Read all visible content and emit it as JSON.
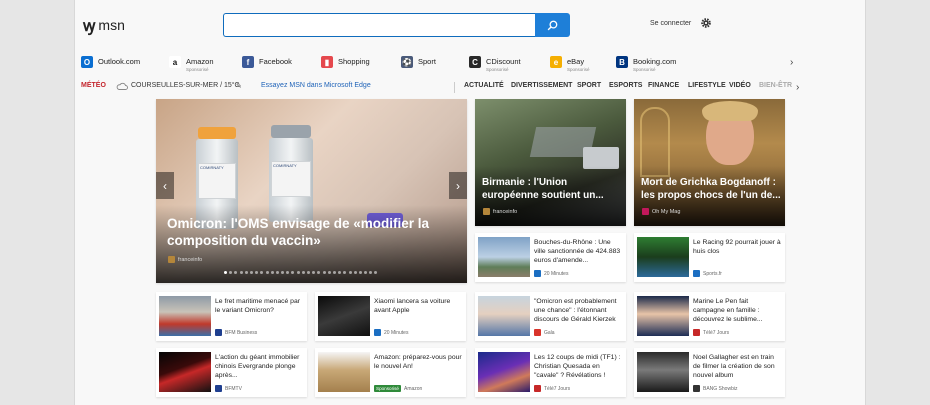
{
  "header": {
    "logo": "msn",
    "search_value": "",
    "signin": "Se connecter",
    "settings_icon": "gear-icon"
  },
  "quicklinks": [
    {
      "label": "Outlook.com",
      "sponsored": "",
      "color": "#0a6ed1",
      "glyph": "O",
      "icon": "outlook-icon"
    },
    {
      "label": "Amazon",
      "sponsored": "Sponsorisé",
      "color": "#ffffff",
      "glyph": "a",
      "icon": "amazon-icon"
    },
    {
      "label": "Facebook",
      "sponsored": "",
      "color": "#3b5998",
      "glyph": "f",
      "icon": "facebook-icon"
    },
    {
      "label": "Shopping",
      "sponsored": "",
      "color": "#e5484d",
      "glyph": "▮",
      "icon": "shopping-bag-icon"
    },
    {
      "label": "Sport",
      "sponsored": "",
      "color": "#4a5a7a",
      "glyph": "⚽",
      "icon": "sport-icon"
    },
    {
      "label": "CDiscount",
      "sponsored": "Sponsorisé",
      "color": "#2a2a2a",
      "glyph": "C",
      "icon": "cdiscount-icon"
    },
    {
      "label": "eBay",
      "sponsored": "Sponsorisé",
      "color": "#f5af02",
      "glyph": "e",
      "icon": "ebay-icon"
    },
    {
      "label": "Booking.com",
      "sponsored": "Sponsorisé",
      "color": "#003580",
      "glyph": "B",
      "icon": "booking-icon"
    }
  ],
  "nav": {
    "meteo": "MÉTÉO",
    "city": "COURSEULLES-SUR-MER / 15°C",
    "edge_promo": "Essayez MSN dans Microsoft Edge",
    "categories": [
      "ACTUALITÉ",
      "DIVERTISSEMENT",
      "SPORT",
      "ESPORTS",
      "FINANCE",
      "LIFESTYLE",
      "VIDÉO",
      "BIEN-ÊTR"
    ]
  },
  "hero": {
    "title": "Omicron: l'OMS envisage de «modifier la composition du vaccin»",
    "source": "franceinfo",
    "vial_labels": [
      "COMIRNATY",
      "COMIRNATY",
      "COMIRNATY"
    ],
    "dot_count": 30,
    "active_dot": 0
  },
  "tiles": [
    {
      "title": "Birmanie : l'Union européenne soutient un...",
      "source": "franceinfo",
      "source_color": "#6b5a3c"
    },
    {
      "title": "Mort de Grichka Bogdanoff : les propos chocs de l'un de...",
      "source": "Oh My Mag",
      "source_color": "#c2185b"
    }
  ],
  "cards": [
    {
      "title": "Bouches-du-Rhône : Une ville sanctionnée de 424.883 euros d'amende...",
      "source": "20 Minutes",
      "sponsored": "",
      "src_color": "#1b6ec2"
    },
    {
      "title": "Le Racing 92 pourrait jouer à huis clos",
      "source": "Sports.fr",
      "sponsored": "",
      "src_color": "#1b6ec2"
    },
    {
      "title": "Le fret maritime menacé par le variant Omicron?",
      "source": "BFM Business",
      "sponsored": "",
      "src_color": "#1f3f8f"
    },
    {
      "title": "Xiaomi lancera sa voiture avant Apple",
      "source": "20 Minutes",
      "sponsored": "",
      "src_color": "#1b6ec2"
    },
    {
      "title": "\"Omicron est probablement une chance\" : l'étonnant discours de Gérald Kierzek",
      "source": "Gala",
      "sponsored": "",
      "src_color": "#d9342b"
    },
    {
      "title": "Marine Le Pen fait campagne en famille : découvrez le sublime...",
      "source": "Télé7 Jours",
      "sponsored": "",
      "src_color": "#c62828"
    },
    {
      "title": "L'action du géant immobilier chinois Evergrande plonge après...",
      "source": "BFMTV",
      "sponsored": "",
      "src_color": "#1f3f8f"
    },
    {
      "title": "Amazon: préparez-vous pour le nouvel An!",
      "source": "Amazon",
      "sponsored": "Sponsorisé",
      "src_color": "#333333"
    },
    {
      "title": "Les 12 coups de midi (TF1) : Christian Quesada en \"cavale\" ? Révélations !",
      "source": "Télé7 Jours",
      "sponsored": "",
      "src_color": "#c62828"
    },
    {
      "title": "Noel Gallagher est en train de filmer la création de son nouvel album",
      "source": "BANG Showbiz",
      "sponsored": "",
      "src_color": "#333333"
    }
  ]
}
